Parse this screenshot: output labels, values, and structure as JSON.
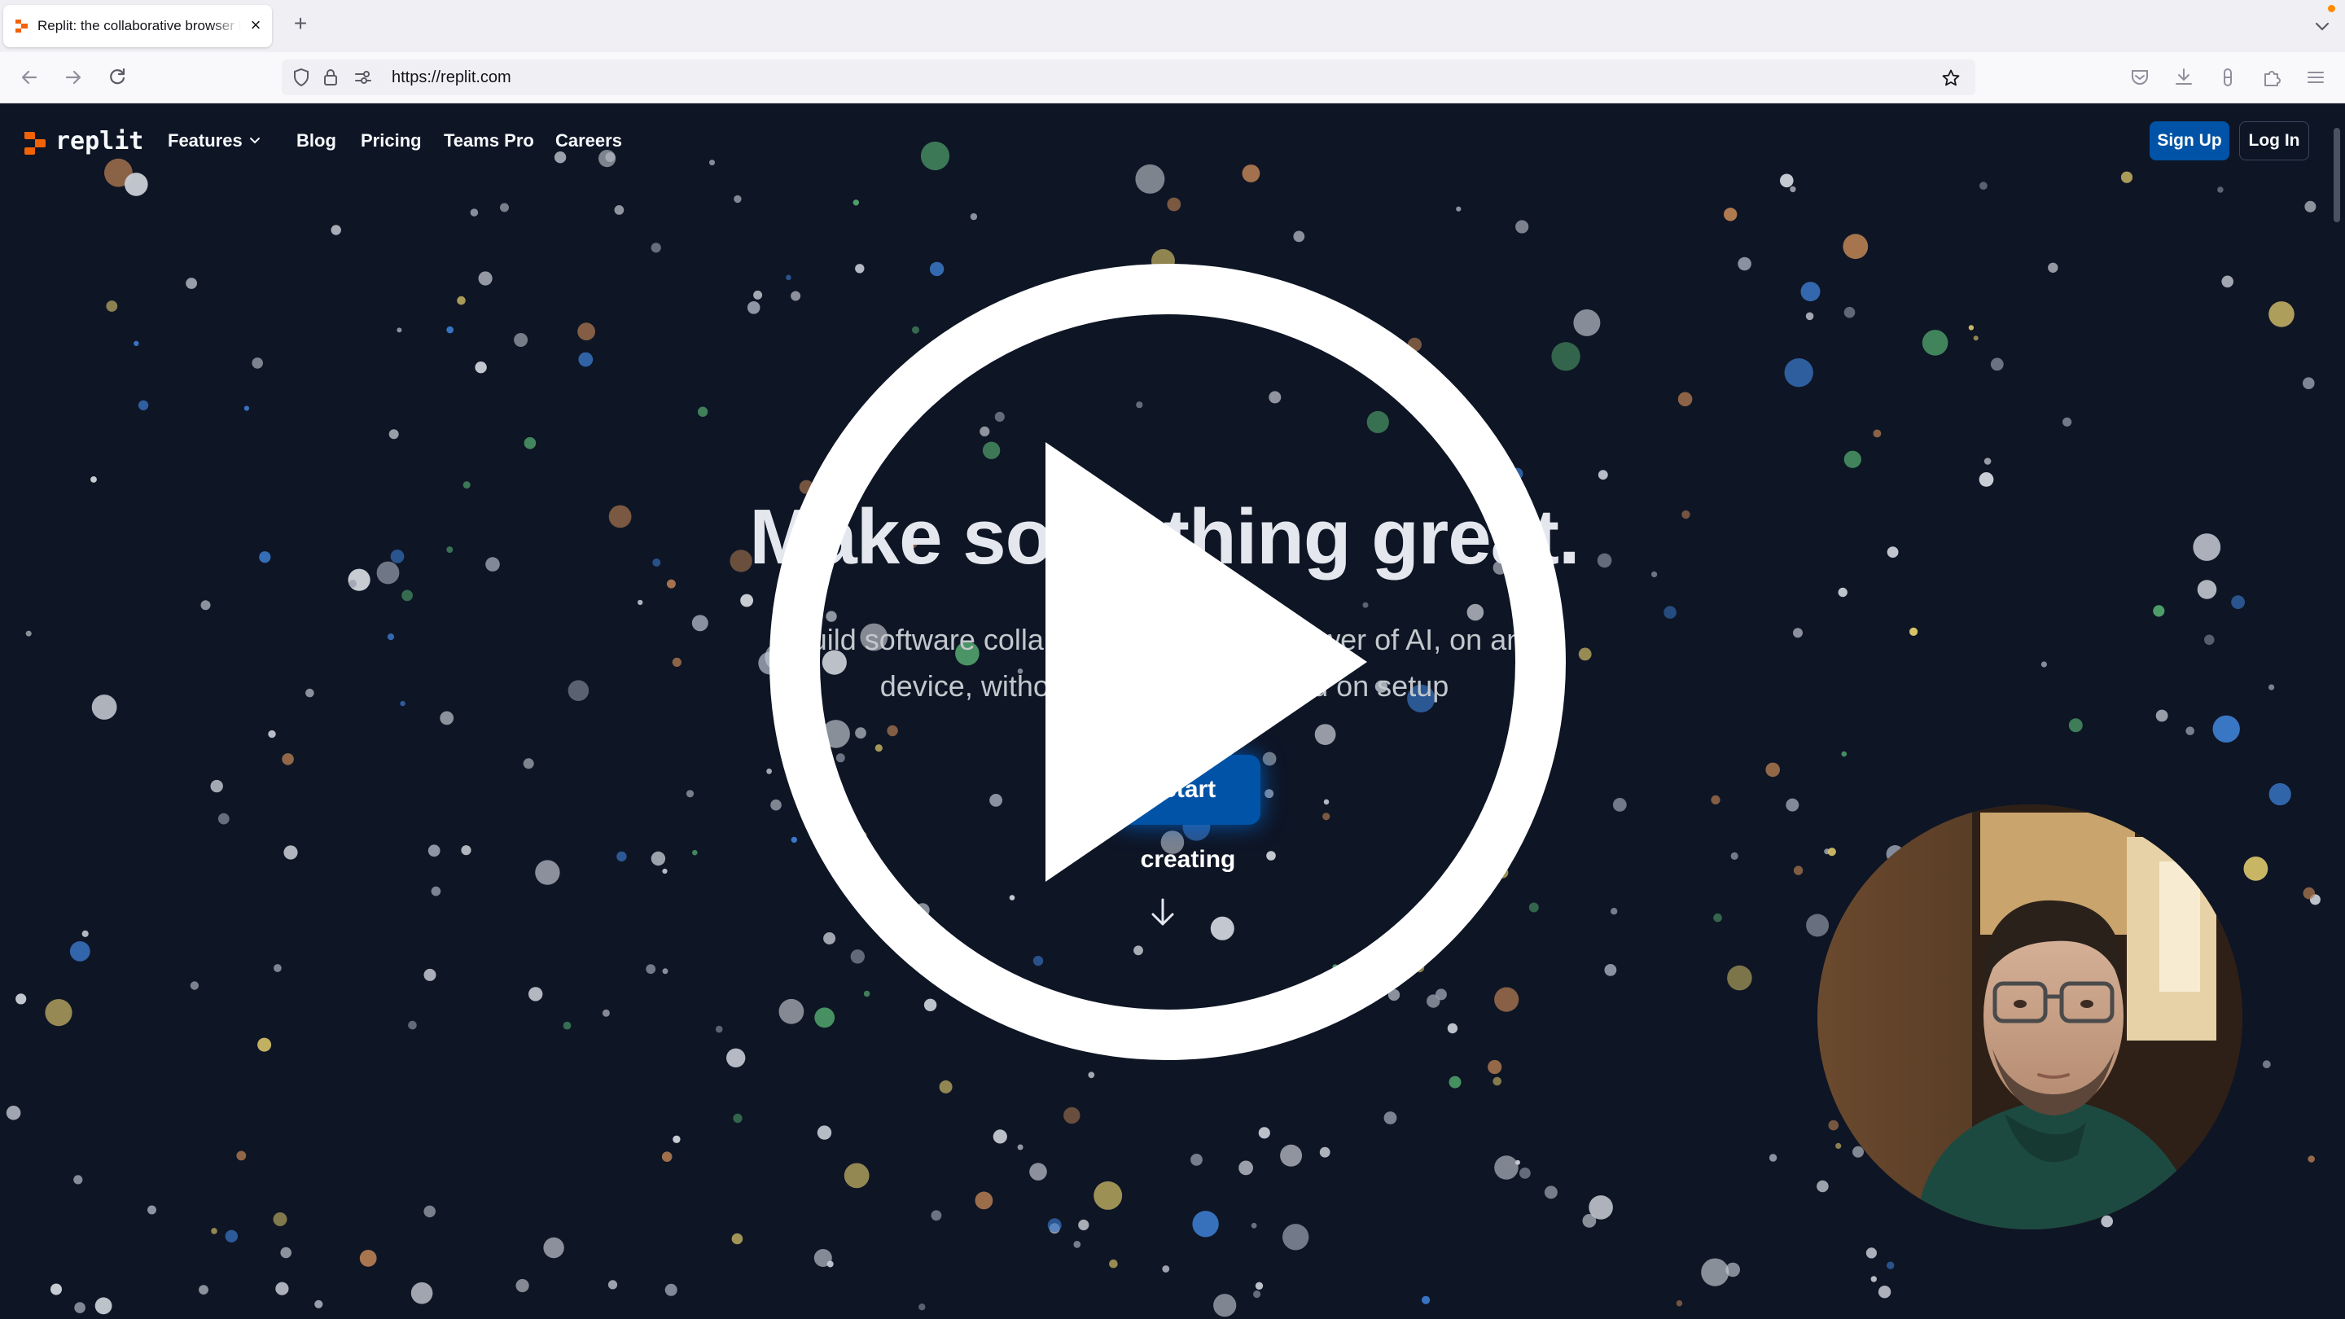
{
  "browser": {
    "tab_title": "Replit: the collaborative browser based IDE",
    "tab_close": "×",
    "new_tab": "+",
    "url": "https://replit.com"
  },
  "site": {
    "logo_text": "replit",
    "nav": [
      "Features",
      "Blog",
      "Pricing",
      "Teams Pro",
      "Careers"
    ],
    "signup_label": "Sign Up",
    "login_label": "Log In"
  },
  "hero": {
    "title": "Make something great.",
    "subtitle": "Build software collaboratively with the power of AI, on any device, without spending a second on setup",
    "cta_label": "Start creating"
  },
  "overlay": {
    "play_icon": "play-icon",
    "webcam": "presenter-webcam"
  },
  "colors": {
    "page_bg": "#0e1525",
    "brand_orange": "#f26207",
    "button_blue": "#0053a6"
  }
}
